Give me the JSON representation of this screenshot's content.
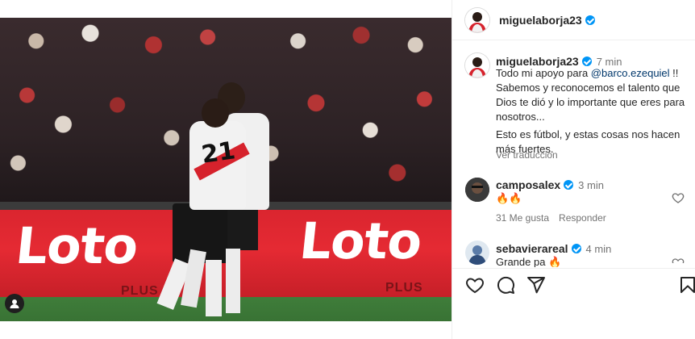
{
  "post": {
    "photo_text": {
      "board_left": "Loto",
      "board_right": "Loto",
      "plus_left": "PLUS",
      "plus_right": "PLUS",
      "jersey_number": "21"
    }
  },
  "header": {
    "username": "miguelaborja23"
  },
  "caption": {
    "username": "miguelaborja23",
    "time": "7 min",
    "line1_prefix": "Todo mi apoyo para ",
    "mention": "@barco.ezequiel",
    "line1_suffix": " !! Sabemos y reconocemos el talento que Dios te dió y lo importante que eres para nosotros...",
    "line2": "Esto es fútbol, y estas cosas nos hacen más fuertes.",
    "see_translation": "Ver traducción"
  },
  "comments": [
    {
      "username": "camposalex",
      "time": "3 min",
      "text": "🔥🔥",
      "likes": "31 Me gusta",
      "reply": "Responder"
    },
    {
      "username": "sebavierareal",
      "time": "4 min",
      "text": "Grande pa 🔥"
    }
  ],
  "icons": [
    "heart-icon",
    "comment-icon",
    "share-icon",
    "bookmark-icon",
    "more-icon",
    "tag-user-icon"
  ],
  "colors": {
    "verified": "#0095f6",
    "mention": "#00376b",
    "muted": "#737373",
    "board_red": "#e52a33"
  }
}
